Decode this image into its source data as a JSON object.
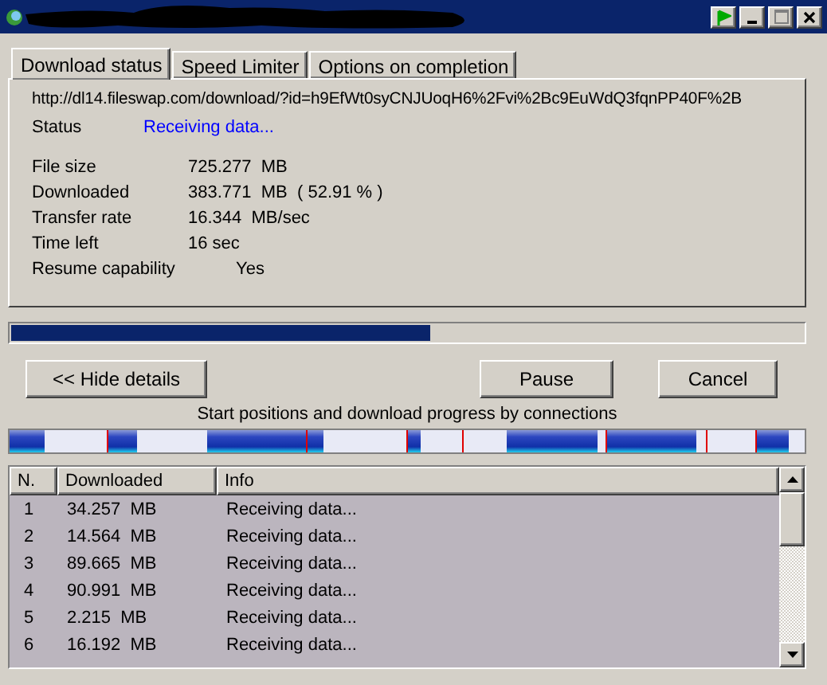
{
  "tabs": [
    {
      "label": "Download status",
      "selected": true
    },
    {
      "label": "Speed Limiter",
      "selected": false
    },
    {
      "label": "Options on completion",
      "selected": false
    }
  ],
  "url": "http://dl14.fileswap.com/download/?id=h9EfWt0syCNJUoqH6%2Fvi%2Bc9EuWdQ3fqnPP40F%2B",
  "status": {
    "label": "Status",
    "value": "Receiving data..."
  },
  "details": [
    {
      "label": "File size",
      "value": "725.277  MB"
    },
    {
      "label": "Downloaded",
      "value": "383.771  MB  ( 52.91 % )"
    },
    {
      "label": "Transfer rate",
      "value": "16.344  MB/sec"
    },
    {
      "label": "Time left",
      "value": "16 sec"
    },
    {
      "label": "Resume capability",
      "value": "Yes",
      "kind": "indented"
    }
  ],
  "progress": {
    "level": 0.5291
  },
  "buttons": [
    {
      "label": "<< Hide details"
    },
    {
      "label": "Pause"
    },
    {
      "label": "Cancel"
    }
  ],
  "connections_caption": "Start positions and download progress by connections",
  "connections": {
    "columns": [
      "N.",
      "Downloaded",
      "Info"
    ],
    "rows": [
      {
        "n": "1",
        "downloaded": "34.257  MB",
        "info": "Receiving data..."
      },
      {
        "n": "2",
        "downloaded": "14.564  MB",
        "info": "Receiving data..."
      },
      {
        "n": "3",
        "downloaded": "89.665  MB",
        "info": "Receiving data..."
      },
      {
        "n": "4",
        "downloaded": "90.991  MB",
        "info": "Receiving data..."
      },
      {
        "n": "5",
        "downloaded": "2.215  MB",
        "info": "Receiving data..."
      },
      {
        "n": "6",
        "downloaded": "16.192  MB",
        "info": "Receiving data..."
      }
    ]
  }
}
